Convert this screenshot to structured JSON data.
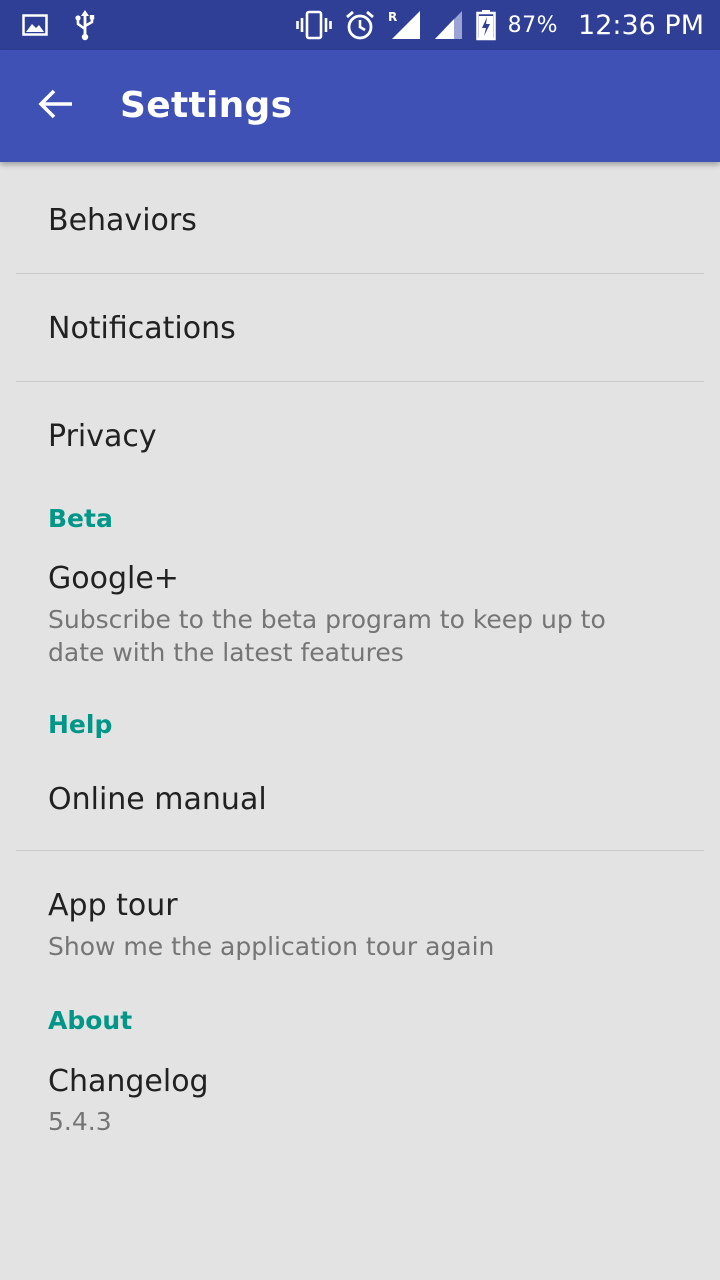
{
  "status_bar": {
    "battery_percent": "87%",
    "time": "12:36 PM",
    "icons": [
      "image-icon",
      "usb-icon",
      "vibrate-icon",
      "alarm-icon",
      "signal-roaming-icon",
      "signal-icon",
      "battery-charging-icon"
    ],
    "roaming_label": "R"
  },
  "app_bar": {
    "title": "Settings",
    "back_icon": "arrow-left-icon",
    "color": "#3f51b5"
  },
  "sections": {
    "top": {
      "items": [
        {
          "title": "Behaviors"
        },
        {
          "title": "Notifications"
        },
        {
          "title": "Privacy"
        }
      ]
    },
    "beta": {
      "header": "Beta",
      "items": [
        {
          "title": "Google+",
          "summary": "Subscribe to the beta program to keep up to date with the latest features"
        }
      ]
    },
    "help": {
      "header": "Help",
      "items": [
        {
          "title": "Online manual"
        },
        {
          "title": "App tour",
          "summary": "Show me the application tour again"
        }
      ]
    },
    "about": {
      "header": "About",
      "items": [
        {
          "title": "Changelog",
          "summary": "5.4.3"
        }
      ]
    }
  },
  "colors": {
    "status_bar": "#2e3f95",
    "accent": "#009688",
    "background": "#e3e3e3"
  }
}
